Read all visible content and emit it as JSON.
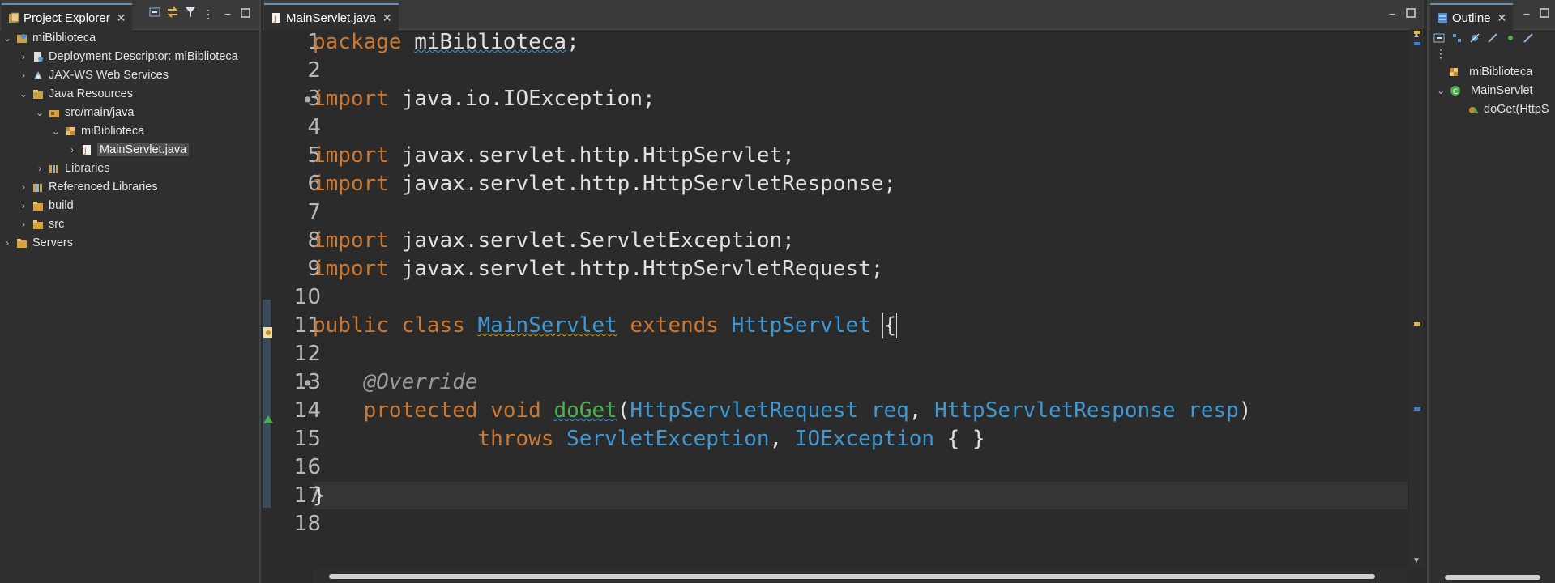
{
  "project_explorer": {
    "tab_label": "Project Explorer",
    "tree": [
      {
        "label": "miBiblioteca",
        "expanded": true,
        "icon": "project-icon"
      },
      {
        "label": "Deployment Descriptor: miBiblioteca",
        "icon": "descriptor-icon"
      },
      {
        "label": "JAX-WS Web Services",
        "icon": "webservices-icon"
      },
      {
        "label": "Java Resources",
        "expanded": true,
        "icon": "java-resources-icon"
      },
      {
        "label": "src/main/java",
        "expanded": true,
        "icon": "source-folder-icon"
      },
      {
        "label": "miBiblioteca",
        "expanded": true,
        "icon": "package-icon"
      },
      {
        "label": "MainServlet.java",
        "selected": true,
        "icon": "java-file-icon"
      },
      {
        "label": "Libraries",
        "icon": "libraries-icon"
      },
      {
        "label": "Referenced Libraries",
        "icon": "libraries-icon"
      },
      {
        "label": "build",
        "icon": "folder-icon"
      },
      {
        "label": "src",
        "icon": "folder-icon"
      },
      {
        "label": "Servers",
        "icon": "folder-icon"
      }
    ]
  },
  "editor": {
    "tab_label": "MainServlet.java",
    "lines": [
      {
        "n": "1"
      },
      {
        "n": "2"
      },
      {
        "n": "3"
      },
      {
        "n": "4"
      },
      {
        "n": "5"
      },
      {
        "n": "6"
      },
      {
        "n": "7"
      },
      {
        "n": "8"
      },
      {
        "n": "9"
      },
      {
        "n": "10"
      },
      {
        "n": "11"
      },
      {
        "n": "12"
      },
      {
        "n": "13"
      },
      {
        "n": "14"
      },
      {
        "n": "15"
      },
      {
        "n": "16"
      },
      {
        "n": "17"
      },
      {
        "n": "18"
      }
    ],
    "tokens": {
      "l1": [
        "package",
        " ",
        "miBiblioteca",
        ";"
      ],
      "l3": [
        "import",
        " java.io.IOException;"
      ],
      "l5": [
        "import",
        " javax.servlet.http.HttpServlet;"
      ],
      "l6": [
        "import",
        " javax.servlet.http.HttpServletResponse;"
      ],
      "l8": [
        "import",
        " javax.servlet.ServletException;"
      ],
      "l9": [
        "import",
        " javax.servlet.http.HttpServletRequest;"
      ],
      "l11": [
        "public",
        " ",
        "class",
        " ",
        "MainServlet",
        " ",
        "extends",
        " ",
        "HttpServlet",
        " ",
        "{"
      ],
      "l13": [
        "    ",
        "@Override"
      ],
      "l14": [
        "    ",
        "protected",
        " ",
        "void",
        " ",
        "doGet",
        "(",
        "HttpServletRequest",
        " ",
        "req",
        ", ",
        "HttpServletResponse",
        " ",
        "resp",
        ")"
      ],
      "l15": [
        "             ",
        "throws",
        " ",
        "ServletException",
        ", ",
        "IOException",
        " { }"
      ],
      "l17": [
        "}"
      ]
    }
  },
  "outline": {
    "tab_label": "Outline",
    "items": [
      {
        "label": "miBiblioteca"
      },
      {
        "label": "MainServlet"
      },
      {
        "label": "doGet(HttpS"
      }
    ]
  },
  "colors": {
    "keyword": "#cc7832",
    "type": "#3d98d3",
    "method": "#4cae4c",
    "annotation": "#9a9a9a"
  }
}
